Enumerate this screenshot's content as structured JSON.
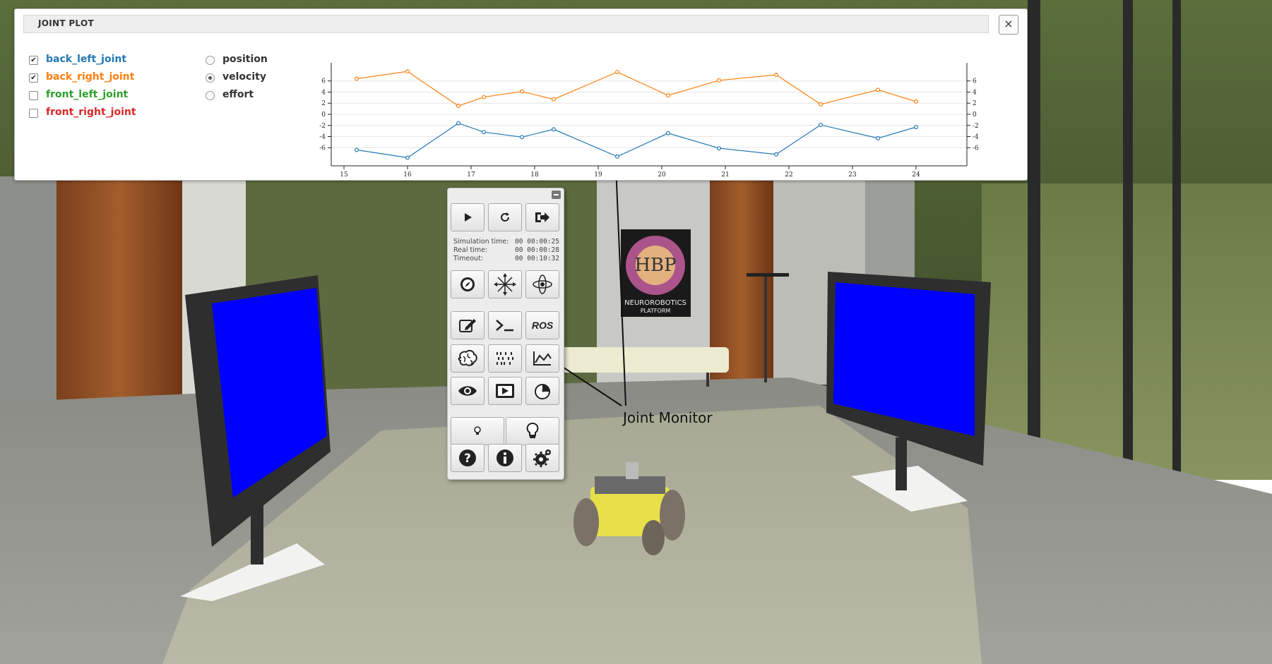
{
  "panel": {
    "title": "JOINT PLOT",
    "close_label": "×",
    "joints": [
      {
        "label": "back_left_joint",
        "checked": true,
        "color": "#1f77b4"
      },
      {
        "label": "back_right_joint",
        "checked": true,
        "color": "#ff7f0e"
      },
      {
        "label": "front_left_joint",
        "checked": false,
        "color": "#2ca02c"
      },
      {
        "label": "front_right_joint",
        "checked": false,
        "color": "#d62728"
      }
    ],
    "modes": [
      {
        "label": "position",
        "selected": false
      },
      {
        "label": "velocity",
        "selected": true
      },
      {
        "label": "effort",
        "selected": false
      }
    ]
  },
  "chart_data": {
    "type": "line",
    "x": [
      15.2,
      16.0,
      16.8,
      17.2,
      17.8,
      18.3,
      19.3,
      20.1,
      20.9,
      21.8,
      22.5,
      23.4,
      24.0
    ],
    "series": [
      {
        "name": "back_left_joint",
        "color": "#1f77b4",
        "values": [
          -6.4,
          -7.8,
          -1.6,
          -3.2,
          -4.1,
          -2.7,
          -7.6,
          -3.4,
          -6.1,
          -7.2,
          -1.9,
          -4.3,
          -2.3
        ]
      },
      {
        "name": "back_right_joint",
        "color": "#ff7f0e",
        "values": [
          6.4,
          7.7,
          1.5,
          3.1,
          4.1,
          2.7,
          7.6,
          3.4,
          6.1,
          7.1,
          1.8,
          4.4,
          2.3
        ]
      }
    ],
    "xlim": [
      14.8,
      24.8
    ],
    "ylim": [
      -8.5,
      8.5
    ],
    "x_ticks": [
      15,
      16,
      17,
      18,
      19,
      20,
      21,
      22,
      23,
      24
    ],
    "y_ticks": [
      -6,
      -4,
      -2,
      0,
      2,
      4,
      6
    ],
    "grid": true,
    "legend": "none"
  },
  "toolbar": {
    "sim_time_label": "Simulation time:",
    "sim_time_value": "00 00:00:25",
    "real_time_label": "Real time:",
    "real_time_value": "00 00:00:28",
    "timeout_label": "Timeout:",
    "timeout_value": "00 00:10:32",
    "ros_label": "ROS",
    "icons": [
      "play-icon",
      "reset-icon",
      "exit-icon",
      "compass-icon",
      "move-icon",
      "rotate-icon",
      "edit-icon",
      "terminal-icon",
      "brain-icon",
      "spike-train-icon",
      "joint-monitor-icon",
      "eye-icon",
      "video-icon",
      "gauge-icon",
      "light-small-icon",
      "light-large-icon",
      "help-icon",
      "info-icon",
      "settings-icon"
    ]
  },
  "annotation": {
    "label": "Joint Monitor"
  },
  "scene": {
    "poster_text_1": "HBP",
    "poster_text_2": "NEUROROBOTICS",
    "poster_text_3": "PLATFORM",
    "screen_color": "#0000ff"
  }
}
